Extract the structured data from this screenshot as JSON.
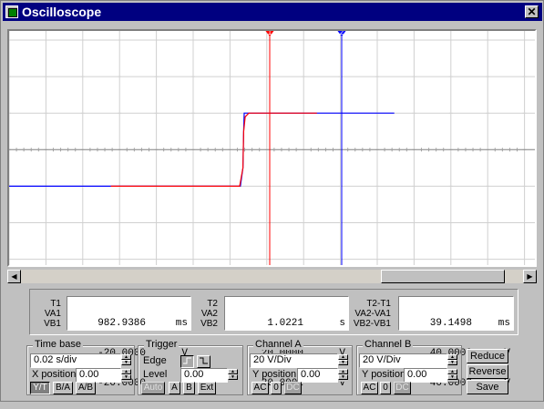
{
  "window": {
    "title": "Oscilloscope",
    "close_glyph": "✕"
  },
  "screen": {
    "cursor1_label": "1",
    "cursor2_label": "2",
    "channel_a_color": "#ff0000",
    "channel_b_color": "#0000ff",
    "cursor1_color": "#ff0000",
    "cursor2_color": "#0000ff",
    "channel_a_trace": [
      [
        0,
        -20.0
      ],
      [
        0.07,
        -20.0
      ],
      [
        0.0718,
        -10.0
      ],
      [
        0.0722,
        10.0
      ],
      [
        0.073,
        18.0
      ],
      [
        0.075,
        20.0
      ],
      [
        0.112,
        20.0
      ]
    ],
    "channel_b_trace": [
      [
        -0.07,
        -20.0
      ],
      [
        0.0704,
        -20.0
      ],
      [
        0.0718,
        -10.0
      ],
      [
        0.0722,
        10.0
      ],
      [
        0.0725,
        20.0
      ],
      [
        0.154,
        20.0
      ]
    ]
  },
  "scrollbar": {
    "left_arrow": "◀",
    "right_arrow": "▶"
  },
  "readout": {
    "col1": {
      "labels": [
        "T1",
        "VA1",
        "VB1"
      ],
      "values": [
        "982.9386",
        "-20.0000",
        "-20.0000"
      ],
      "units": [
        "ms",
        "V",
        "V"
      ]
    },
    "col2": {
      "labels": [
        "T2",
        "VA2",
        "VB2"
      ],
      "values": [
        "1.0221",
        "20.0000",
        "20.0002"
      ],
      "units": [
        "s",
        "V",
        "V"
      ]
    },
    "col3": {
      "labels": [
        "T2-T1",
        "VA2-VA1",
        "VB2-VB1"
      ],
      "values": [
        "39.1498",
        "40.0000",
        "40.0003"
      ],
      "units": [
        "ms",
        "V",
        "V"
      ]
    }
  },
  "time_base": {
    "title": "Time base",
    "scale": "0.02 s/div",
    "xpos_label": "X position",
    "xpos_value": "0.00",
    "modes": [
      "Y/T",
      "B/A",
      "A/B"
    ]
  },
  "trigger": {
    "title": "Trigger",
    "edge_label": "Edge",
    "level_label": "Level",
    "level_value": "0.00",
    "sources": [
      "Auto",
      "A",
      "B",
      "Ext"
    ]
  },
  "channel_a": {
    "title": "Channel A",
    "scale": "20 V/Div",
    "ypos_label": "Y position",
    "ypos_value": "0.00",
    "coupling": [
      "AC",
      "0",
      "DC"
    ]
  },
  "channel_b": {
    "title": "Channel B",
    "scale": "20 V/Div",
    "ypos_label": "Y position",
    "ypos_value": "0.00",
    "coupling": [
      "AC",
      "0",
      "DC"
    ]
  },
  "actions": {
    "reduce": "Reduce",
    "reverse": "Reverse",
    "save": "Save"
  }
}
